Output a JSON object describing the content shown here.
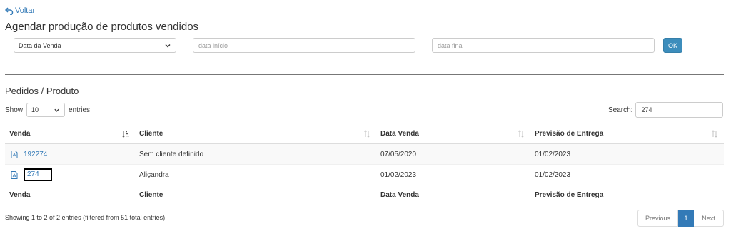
{
  "nav": {
    "back_label": "Voltar"
  },
  "header": {
    "title": "Agendar produção de produtos vendidos"
  },
  "filters": {
    "date_type_selected": "Data da Venda",
    "start_placeholder": "data início",
    "end_placeholder": "data final",
    "ok_label": "OK"
  },
  "section": {
    "title": "Pedidos / Produto"
  },
  "table_controls": {
    "show_label": "Show",
    "length_value": "10",
    "entries_label": "entries",
    "search_label": "Search:",
    "search_value": "274"
  },
  "table": {
    "columns": [
      "Venda",
      "Cliente",
      "Data Venda",
      "Previsão de Entrega"
    ],
    "rows": [
      {
        "venda": "192274",
        "cliente": "Sem cliente definido",
        "data_venda": "07/05/2020",
        "previsao": "01/02/2023"
      },
      {
        "venda": "274",
        "cliente": "Aliçandra",
        "data_venda": "01/02/2023",
        "previsao": "01/02/2023"
      }
    ]
  },
  "footer": {
    "info": "Showing 1 to 2 of 2 entries (filtered from 51 total entries)",
    "prev_label": "Previous",
    "page_label": "1",
    "next_label": "Next"
  },
  "icons": {
    "back": "undo-arrow-icon",
    "row": "pdf-file-icon",
    "sort_active": "sort-amount-down-icon",
    "sort": "sort-arrows-icon"
  },
  "colors": {
    "link": "#337ab7",
    "button": "#3c8dbc",
    "active_page": "#337ab7"
  }
}
